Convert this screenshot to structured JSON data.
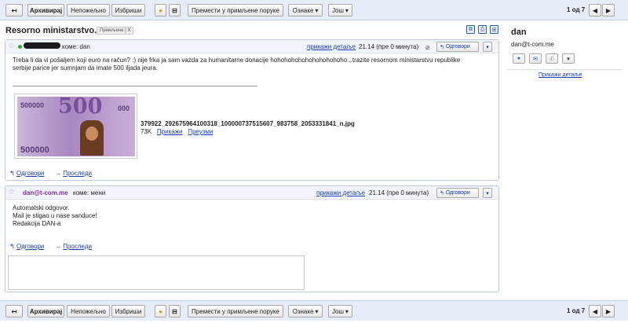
{
  "toolbar": {
    "back_icon": "arrow-left-icon",
    "archive": "Архивирај",
    "not_spam": "Непожељно",
    "delete": "Избриши",
    "move_to_inbox": "Премести у примљене поруке",
    "labels": "Ознаке",
    "more": "Још",
    "pager": "1 од 7"
  },
  "conversation": {
    "subject": "Resorno ministarstvo.",
    "label_chip": "Примљене | X"
  },
  "message1": {
    "to": "коме: dan",
    "show_details": "прикажи детаље",
    "time": "21.14 (пре 0 минута)",
    "reply": "Одговори",
    "body_line1": "Treba li da vi pošaljem koji euro na račun? :) nije frka ja sam vazda za humanitarne donacije hohohohohohohohohohoho...trazite resornom ministarstvu republike",
    "body_line2": "serbije parice jer sumnjam da imate 500 iljada jeura.",
    "banknote": {
      "big_value": "500",
      "corner_top": "500000",
      "corner_right": "000",
      "corner_bottom": "500000"
    },
    "attachment": {
      "filename": "379922_292675964100318_100000737515607_983758_2053331841_n.jpg",
      "size": "73K",
      "view": "Прикажи",
      "download": "Преузми"
    },
    "action_reply": "Одговори",
    "action_forward": "Проследи"
  },
  "message2": {
    "sender": "dan@t-com.me",
    "to": "коме: мени",
    "show_details": "прикажи детаље",
    "time": "21.14 (пре 0 минута)",
    "reply": "Одговори",
    "body": [
      "Automatski odgovor.",
      "Mail je stigao u nase sanduce!",
      "Redakcija DAN-a"
    ],
    "action_reply": "Одговори",
    "action_forward": "Проследи"
  },
  "sidebar": {
    "name": "dan",
    "email": "dan@t-com.me",
    "show_details": "Прикажи детаље"
  },
  "colors": {
    "toolbar_bg": "#e6ecf8",
    "link": "#1c3db4",
    "online": "#3aa63a"
  }
}
